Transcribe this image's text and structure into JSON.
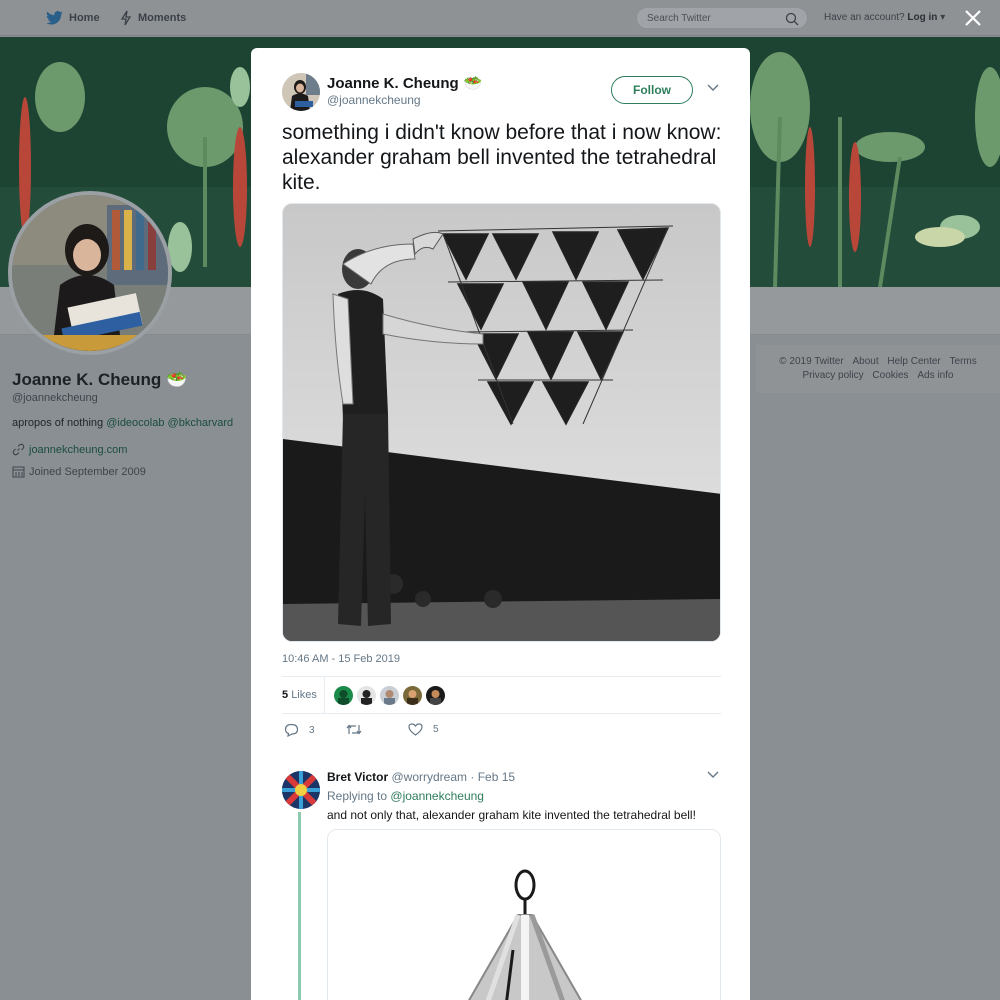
{
  "topbar": {
    "home_label": "Home",
    "moments_label": "Moments",
    "search_placeholder": "Search Twitter",
    "account_prompt": "Have an account?",
    "login_label": "Log in"
  },
  "profile": {
    "name": "Joanne K. Cheung",
    "name_emoji": "🥗",
    "handle": "@joannekcheung",
    "bio_prefix": "apropos of nothing",
    "bio_mention_1": "@ideocolab",
    "bio_mention_2": "@bkcharvard",
    "url": "joannekcheung.com",
    "joined": "Joined September 2009"
  },
  "footer": {
    "links_row1": [
      "© 2019 Twitter",
      "About",
      "Help Center",
      "Terms"
    ],
    "links_row2": [
      "Privacy policy",
      "Cookies",
      "Ads info"
    ]
  },
  "tweet": {
    "author_name": "Joanne K. Cheung",
    "author_emoji": "🥗",
    "author_handle": "@joannekcheung",
    "follow_label": "Follow",
    "text": "something i didn't know before that i now know: alexander graham bell invented the tetrahedral kite.",
    "timestamp": "10:46 AM - 15 Feb 2019",
    "likes_count": "5",
    "likes_label": "Likes",
    "reply_count": "3",
    "like_action_count": "5"
  },
  "reply": {
    "author_name": "Bret Victor",
    "author_handle": "@worrydream",
    "date": "· Feb 15",
    "replying_to_label": "Replying to",
    "replying_to_handle": "@joannekcheung",
    "text": "and not only that, alexander graham kite invented the tetrahedral bell!"
  },
  "colors": {
    "accent": "#2e7d5b",
    "link": "#1a4d3c",
    "thread_line": "#8dc8b0"
  }
}
